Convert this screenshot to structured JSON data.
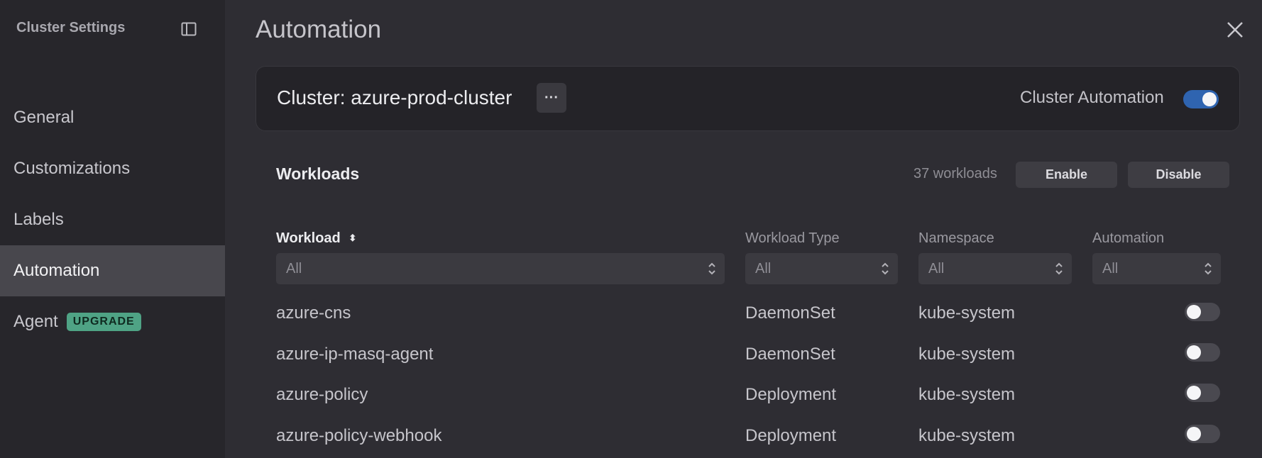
{
  "sidebar": {
    "title": "Cluster Settings",
    "items": [
      {
        "label": "General"
      },
      {
        "label": "Customizations"
      },
      {
        "label": "Labels"
      },
      {
        "label": "Automation"
      },
      {
        "label": "Agent",
        "badge": "UPGRADE"
      }
    ]
  },
  "header": {
    "title": "Automation"
  },
  "cluster": {
    "name": "Cluster: azure-prod-cluster",
    "more_label": "···",
    "automation_label": "Cluster Automation",
    "automation_enabled": true
  },
  "workloads": {
    "title": "Workloads",
    "count": "37 workloads",
    "enable_label": "Enable",
    "disable_label": "Disable",
    "columns": [
      "Workload",
      "Workload Type",
      "Namespace",
      "Automation"
    ],
    "filters": [
      "All",
      "All",
      "All",
      "All"
    ],
    "rows": [
      {
        "name": "azure-cns",
        "type": "DaemonSet",
        "namespace": "kube-system",
        "automation": false
      },
      {
        "name": "azure-ip-masq-agent",
        "type": "DaemonSet",
        "namespace": "kube-system",
        "automation": false
      },
      {
        "name": "azure-policy",
        "type": "Deployment",
        "namespace": "kube-system",
        "automation": false
      },
      {
        "name": "azure-policy-webhook",
        "type": "Deployment",
        "namespace": "kube-system",
        "automation": false
      }
    ]
  },
  "colors": {
    "accent": "#2f64b0",
    "badge": "#4fa385"
  }
}
